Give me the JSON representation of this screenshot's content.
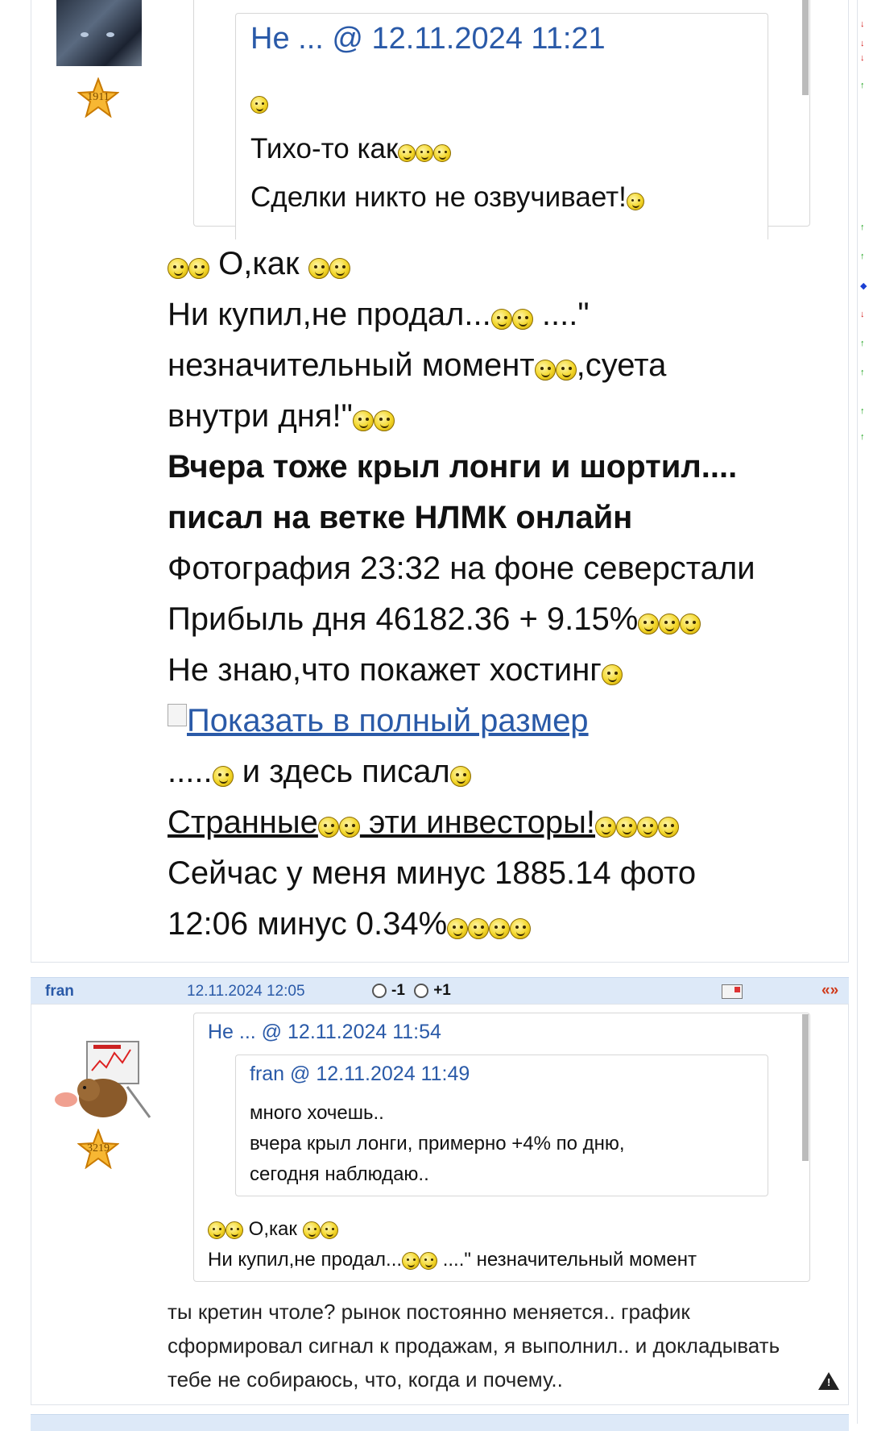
{
  "post1": {
    "user_rating": "1911",
    "quote": {
      "header": "Не ... @ 12.11.2024 11:21",
      "line1": "Тихо-то как",
      "line2": "Сделки никто не озвучивает!"
    },
    "body": {
      "line1": "О,как",
      "line2": "Ни купил,не продал...",
      "line2b": "....\"",
      "line3a": "незначительный момент",
      "line3b": ",суета",
      "line4": "внутри дня!\"",
      "bold1": "Вчера тоже крыл лонги и шортил....",
      "bold2": "писал на ветке НЛМК онлайн",
      "line7": "Фотография 23:32 на фоне северстали",
      "line8": "Прибыль дня 46182.36 + 9.15%",
      "line9": "Не знаю,что покажет хостинг",
      "image_link": "Показать в полный размер",
      "line11a": ".....",
      "line11b": " и здесь писал",
      "link2a": "Странные",
      "link2b": " эти инвесторы!",
      "line13": "Сейчас у меня минус 1885.14 фото",
      "line14": "12:06 минус 0.34%"
    }
  },
  "post2": {
    "bar": {
      "username": "fran",
      "datetime": "12.11.2024 12:05",
      "vote_minus": "-1",
      "vote_plus": "+1",
      "arrows": "«»"
    },
    "user_rating": "3219",
    "quote_outer_header": "Не ... @ 12.11.2024 11:54",
    "quote_inner_header": "fran @ 12.11.2024 11:49",
    "quote_inner_lines": [
      "много хочешь..",
      "вчера крыл лонги, примерно +4% по дню,",
      "сегодня наблюдаю.."
    ],
    "quote_outer_line1": "О,как",
    "quote_outer_line2a": "Ни купил,не продал...",
    "quote_outer_line2b": " ....\" незначительный момент",
    "reply": "ты кретин чтоле? рынок постоянно меняется.. график сформировал сигнал к продажам, я выполнил.. и докладывать тебе не собираюсь, что, когда и почему.."
  },
  "colors": {
    "link": "#2a5aa8",
    "bar_bg": "#dde9f8",
    "arrows": "#d03a1a"
  }
}
